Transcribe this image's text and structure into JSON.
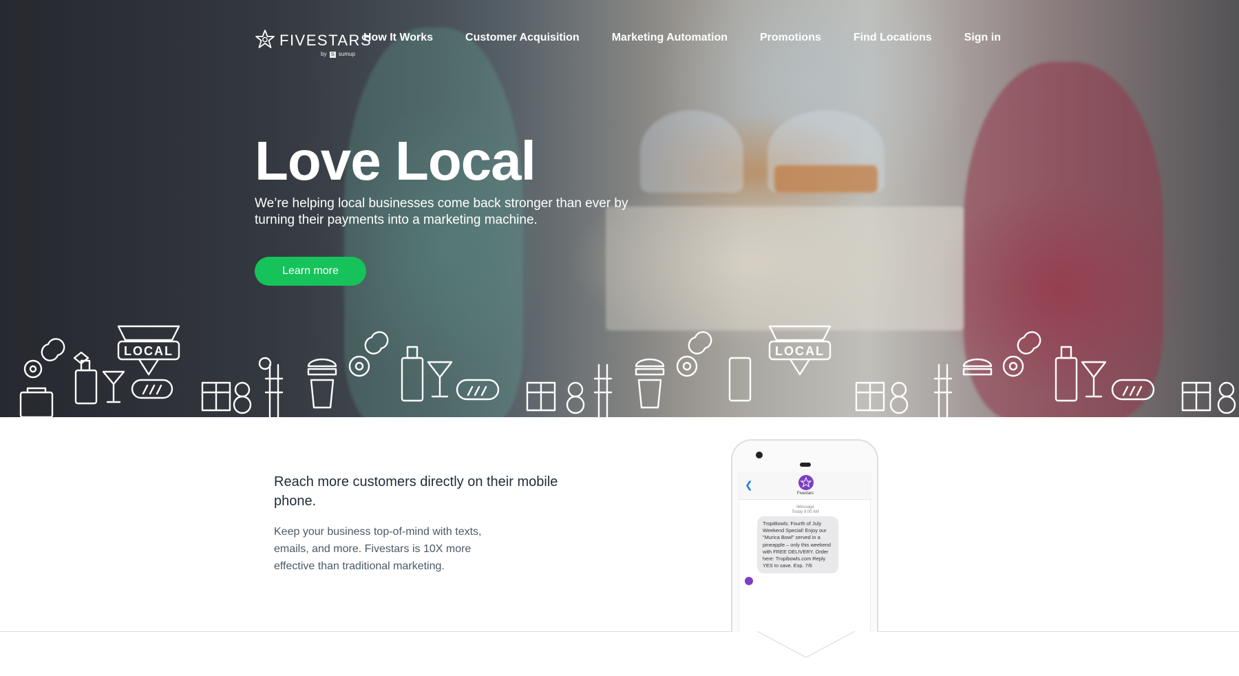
{
  "brand": {
    "name": "FIVESTARS",
    "byline": "by",
    "parent": "sumup"
  },
  "nav": {
    "items": [
      {
        "label": "How It Works"
      },
      {
        "label": "Customer Acquisition"
      },
      {
        "label": "Marketing Automation"
      },
      {
        "label": "Promotions"
      },
      {
        "label": "Find Locations"
      },
      {
        "label": "Sign in"
      }
    ]
  },
  "hero": {
    "title": "Love Local",
    "subtitle": "We’re helping local businesses come back stronger than ever by turning their payments into a marketing machine.",
    "cta_label": "Learn more",
    "doodle_sign": "LOCAL",
    "colors": {
      "cta": "#16c35a"
    }
  },
  "feature": {
    "heading": "Reach more customers directly on their mobile phone.",
    "body": "Keep your business top-of-mind with texts, emails, and more. Fivestars is 10X more effective than traditional marketing."
  },
  "phone": {
    "contact_name": "Fivestars",
    "meta_service": "iMessage",
    "meta_time": "Today 8:00 AM",
    "message": "TropiBowls: Fourth of July Weekend Special! Enjoy our \"Murica Bowl\" served in a pineapple – only this weekend with FREE DELIVERY. Order here: Tropibowls.com Reply YES to save. Exp. 7/6"
  },
  "icons": [
    "star-logo-icon",
    "back-chevron-icon",
    "down-chevron-icon"
  ]
}
